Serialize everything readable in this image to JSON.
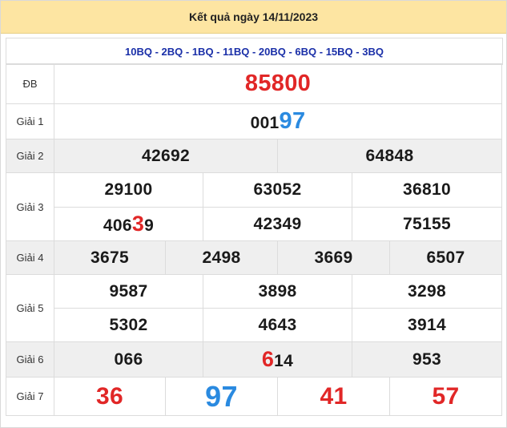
{
  "header": {
    "title": "Kết quả ngày 14/11/2023"
  },
  "codes": "10BQ - 2BQ - 1BQ - 11BQ - 20BQ - 6BQ - 15BQ - 3BQ",
  "prizes": {
    "db": {
      "label": "ĐB",
      "value": "85800"
    },
    "g1": {
      "label": "Giải 1",
      "prefix": "001",
      "suffix": "97"
    },
    "g2": {
      "label": "Giải 2",
      "values": [
        "42692",
        "64848"
      ]
    },
    "g3": {
      "label": "Giải 3",
      "row1": [
        "29100",
        "63052",
        "36810"
      ],
      "r2c1_prefix": "406",
      "r2c1_hl": "3",
      "r2c1_suffix": "9",
      "row2": [
        "42349",
        "75155"
      ]
    },
    "g4": {
      "label": "Giải 4",
      "values": [
        "3675",
        "2498",
        "3669",
        "6507"
      ]
    },
    "g5": {
      "label": "Giải 5",
      "row1": [
        "9587",
        "3898",
        "3298"
      ],
      "row2": [
        "5302",
        "4643",
        "3914"
      ]
    },
    "g6": {
      "label": "Giải 6",
      "v1": "066",
      "v2_hl": "6",
      "v2_suffix": "14",
      "v3": "953"
    },
    "g7": {
      "label": "Giải 7",
      "values": [
        "36",
        "97",
        "41",
        "57"
      ]
    }
  },
  "colors": {
    "header_bg": "#fde5a2",
    "codes_text": "#1a2fa8",
    "red": "#e12727",
    "blue": "#2a8ae0",
    "row_gray": "#efefef"
  }
}
